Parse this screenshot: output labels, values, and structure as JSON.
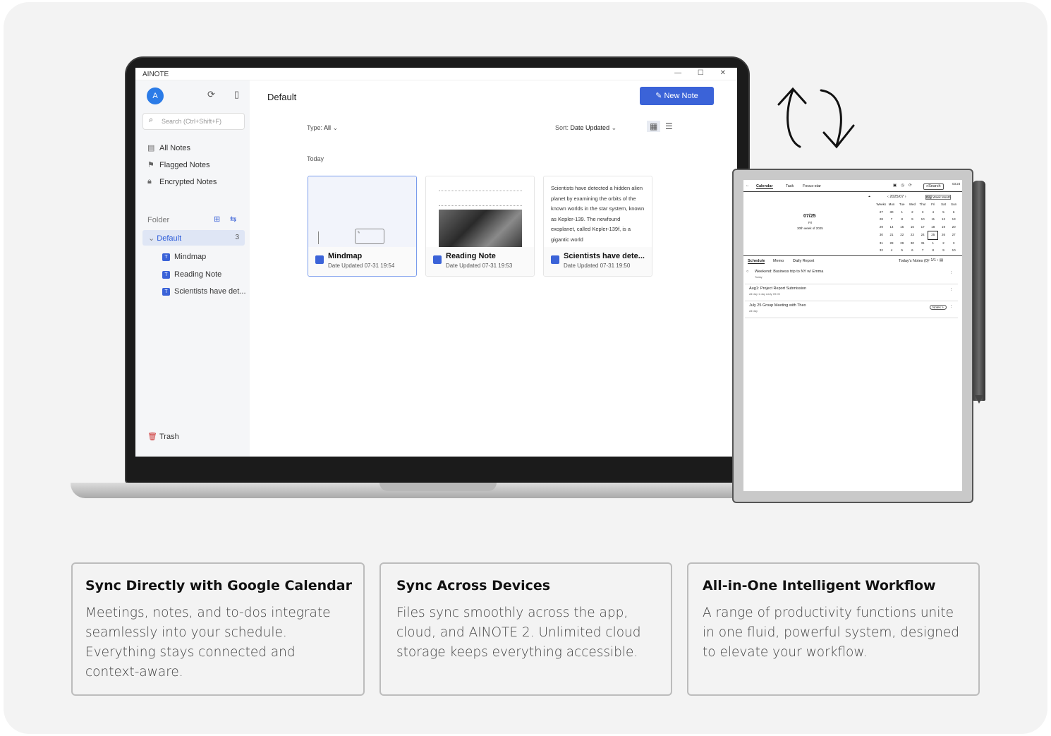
{
  "app": {
    "title": "AINOTE",
    "window_controls": "— ☐ ✕"
  },
  "sidebar": {
    "avatar_letter": "A",
    "search_placeholder": "Search  (Ctrl+Shift+F)",
    "nav": [
      {
        "label": "All Notes",
        "icon": "doc-icon"
      },
      {
        "label": "Flagged Notes",
        "icon": "flag-icon"
      },
      {
        "label": "Encrypted Notes",
        "icon": "lock-icon"
      }
    ],
    "folder_header": "Folder",
    "folder": {
      "label": "Default",
      "count": "3"
    },
    "notes": [
      "Mindmap",
      "Reading Note",
      "Scientists have det..."
    ],
    "trash": "Trash"
  },
  "main": {
    "title": "Default",
    "new_note": "New Note",
    "type_label": "Type:",
    "type_value": "All",
    "sort_label": "Sort:",
    "sort_value": "Date Updated",
    "group": "Today",
    "cards": [
      {
        "title": "Mindmap",
        "date": "Date Updated 07-31 19:54"
      },
      {
        "title": "Reading Note",
        "date": "Date Updated 07-31 19:53"
      },
      {
        "title": "Scientists have dete...",
        "date": "Date Updated 07-31 19:50"
      }
    ],
    "sci_text": "Scientists have detected a hidden alien planet by examining the orbits of the known worlds in the star system, known as Kepler-139. The newfound exoplanet, called Kepler-139f, is a gigantic world"
  },
  "tablet": {
    "tabs": [
      "Calendar",
      "Task",
      "Focus-star"
    ],
    "search": "Search",
    "time": "03:24",
    "date": "07/25",
    "weekday": "Fri",
    "week": "30th week of 2025",
    "month": "2025/07",
    "views": [
      "Day",
      "Week",
      "Month"
    ],
    "cal_header": [
      "Weeks",
      "Mon",
      "Tue",
      "Wed",
      "Thur",
      "Fri",
      "Sat",
      "Sun"
    ],
    "cal_rows": [
      [
        "27",
        "30",
        "1",
        "2",
        "3",
        "4",
        "5",
        "6"
      ],
      [
        "28",
        "7",
        "8",
        "9",
        "10",
        "11",
        "12",
        "13"
      ],
      [
        "29",
        "14",
        "15",
        "16",
        "17",
        "18",
        "19",
        "20"
      ],
      [
        "30",
        "21",
        "22",
        "23",
        "24",
        "25",
        "26",
        "27"
      ],
      [
        "31",
        "28",
        "29",
        "30",
        "31",
        "1",
        "2",
        "3"
      ],
      [
        "32",
        "4",
        "5",
        "6",
        "7",
        "8",
        "9",
        "10"
      ]
    ],
    "lower_tabs": [
      "Schedule",
      "Memo",
      "Daily Report"
    ],
    "todays_notes": "Today's Notes (0)",
    "page": "1/1",
    "events": [
      {
        "title": "Weekend: Business trip to NY w/ Emma",
        "sub": "Today"
      },
      {
        "title": "Aug1: Project Report Submission",
        "sub": "All day  1 day early  09:00"
      },
      {
        "title": "July 25 Group Meeting with Theo",
        "sub": "All day",
        "badge": "Notes >"
      }
    ]
  },
  "features": [
    {
      "title": "Sync Directly with Google Calendar",
      "body": "Meetings, notes, and to-dos integrate seamlessly into your schedule. Everything stays connected and context-aware."
    },
    {
      "title": "Sync Across Devices",
      "body": "Files sync smoothly across the app, cloud, and AINOTE 2. Unlimited cloud storage keeps everything accessible."
    },
    {
      "title": "All-in-One Intelligent Workflow",
      "body": "A range of productivity functions unite in one fluid,  powerful system, designed to elevate your workflow."
    }
  ]
}
